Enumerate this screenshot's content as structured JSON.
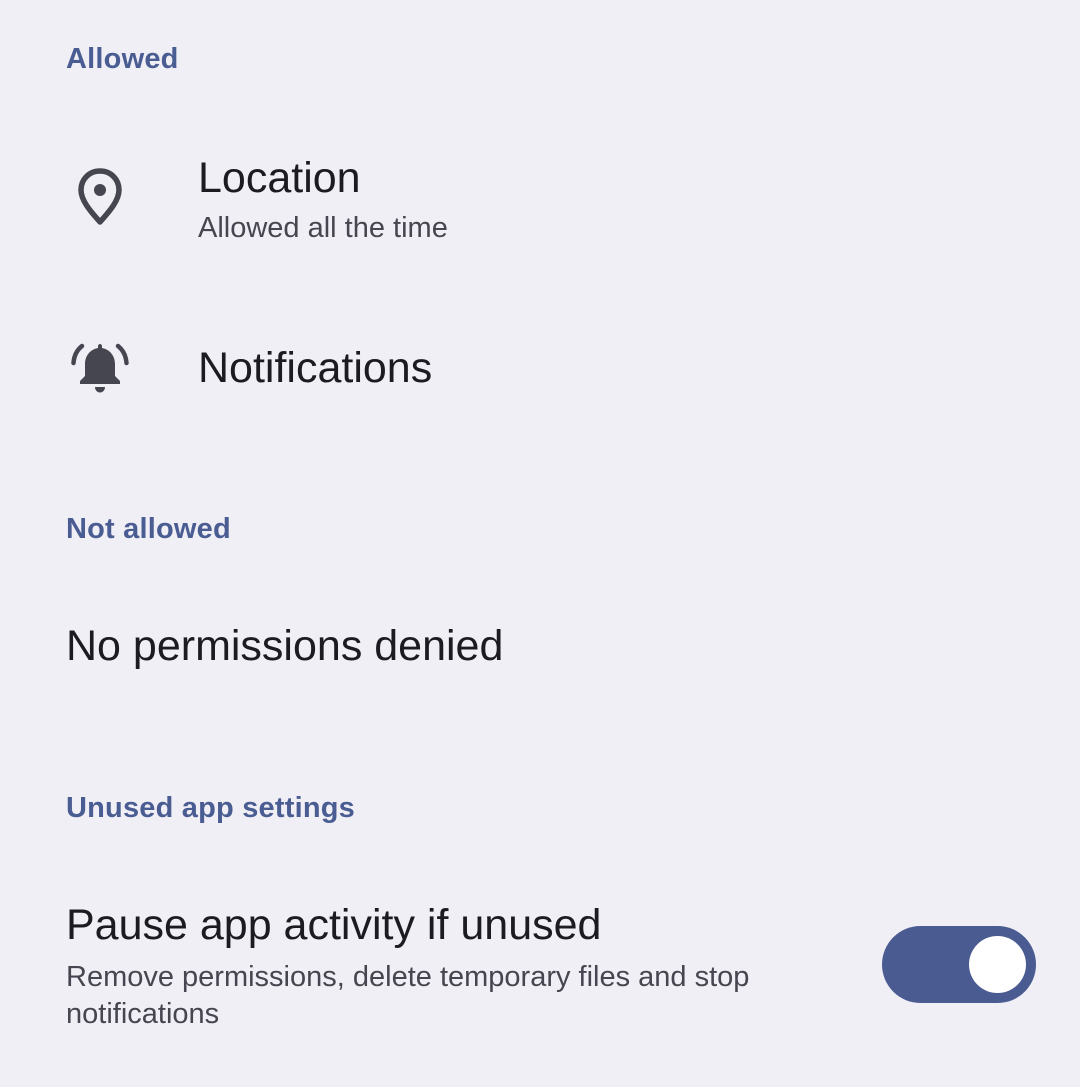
{
  "sections": {
    "allowed": {
      "header": "Allowed",
      "items": [
        {
          "title": "Location",
          "summary": "Allowed all the time",
          "icon": "location-pin-icon"
        },
        {
          "title": "Notifications",
          "icon": "bell-icon"
        }
      ]
    },
    "not_allowed": {
      "header": "Not allowed",
      "empty_text": "No permissions denied"
    },
    "unused": {
      "header": "Unused app settings",
      "pause": {
        "title": "Pause app activity if unused",
        "summary": "Remove permissions, delete temporary files and stop notifications",
        "enabled": true
      }
    }
  },
  "colors": {
    "background": "#f1eff6",
    "accent": "#4a5d92",
    "text_primary": "#1b1b21",
    "text_secondary": "#45464f",
    "switch_track": "#4a5b92"
  }
}
